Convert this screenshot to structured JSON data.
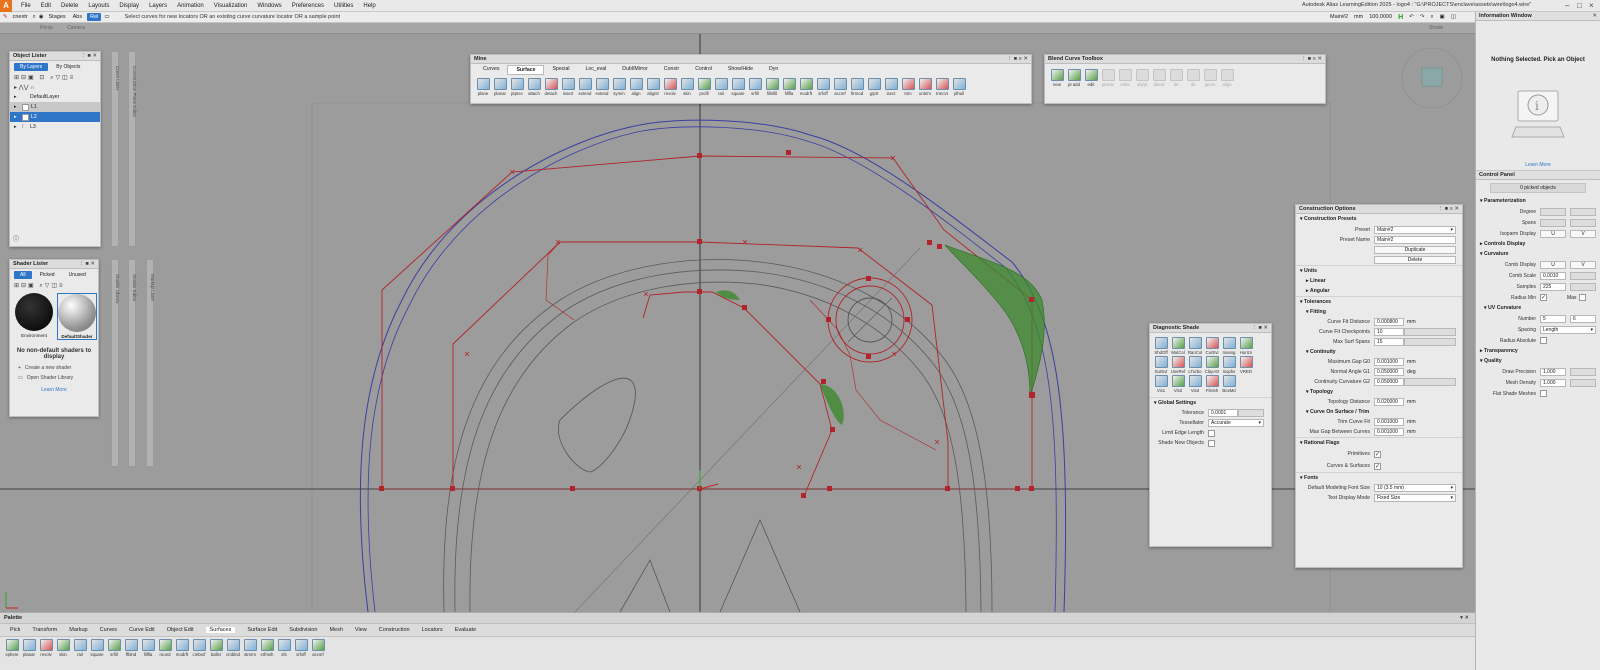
{
  "app": {
    "logo": "A",
    "title": "Autodesk Alias LearningEdition 2025  -  logo4 : \"G:\\PROJECTS\\enclave\\assets\\wire\\logo4.wire\"",
    "menu": [
      "File",
      "Edit",
      "Delete",
      "Layouts",
      "Display",
      "Layers",
      "Animation",
      "Visualization",
      "Windows",
      "Preferences",
      "Utilities",
      "Help"
    ]
  },
  "toolbar": {
    "command": "cnextr",
    "stages": "Stages",
    "abs": "Abs",
    "rel": "Rel",
    "hint": "Select curves for new locators OR an existing curve curvature locator OR a sample point",
    "preset": "Main#2",
    "units": "mm",
    "value": "100.0000"
  },
  "viewport_bar": {
    "items": [
      "Persp",
      "Camera"
    ],
    "right": "Shade"
  },
  "object_lister": {
    "title": "Object Lister",
    "tabs": [
      "By Layers",
      "By Objects"
    ],
    "layers": [
      "DefaultLayer",
      "L1",
      "L2",
      "L3"
    ]
  },
  "shader_lister": {
    "title": "Shader Lister",
    "tabs": [
      "All",
      "Picked",
      "Unused"
    ],
    "shaders": [
      "Environment",
      "DefaultShader"
    ],
    "empty_msg": "No non-default shaders to display",
    "create": "Create a new shader",
    "open": "Open Shader Library",
    "learn": "Learn More"
  },
  "side_bars": [
    "Curve Lister",
    "Construction Plane Editor",
    "Shader Library",
    "Shader Editor",
    "Markup Lister"
  ],
  "mine_shelf": {
    "title": "Mine",
    "tabs": [
      "Curves",
      "Surface",
      "Special",
      "Loc_eval",
      "Dubl/Mirror",
      "Constr",
      "Control",
      "Show/Hide",
      "Dyn"
    ],
    "active_tab": "Surface",
    "tools": [
      "plane",
      "planar",
      "ptprec",
      "attach",
      "detach",
      "insert",
      "extend",
      "extend",
      "symm",
      "align",
      "align0",
      "revolv",
      "skin",
      "profil",
      "rail",
      "square",
      "srfill",
      "fillsfill",
      "fillfla",
      "modrft",
      "srfoff",
      "accsrf",
      "ftrmod",
      "grprt",
      "isect",
      "trim",
      "untrim",
      "trmcvt",
      "plhull"
    ]
  },
  "blend_toolbox": {
    "title": "Blend Curve Toolbox",
    "tools": [
      "new",
      "pt add",
      "edit",
      "planar",
      "ortho",
      "obj/pt",
      "blend",
      "dir",
      "dir",
      "geom",
      "align"
    ]
  },
  "diagnostic_shade": {
    "title": "Diagnostic Shade",
    "icons": [
      "ShdOff",
      "MulCol",
      "RanCol",
      "CurEvl",
      "Isoang",
      "Horizn",
      "SurEvl",
      "UseRef",
      "LTurbo",
      "ClayAO",
      "Isophs",
      "VRED",
      "Vis1",
      "Vis2",
      "Vis3",
      "FileSh",
      "BoxMd"
    ],
    "global_settings": "Global Settings",
    "tolerance_label": "Tolerance",
    "tolerance": "0.0001",
    "tessellator_label": "Tessellator",
    "tessellator": "Accurate",
    "limit_edge": "Limit Edge Length",
    "shade_new": "Shade New Objects"
  },
  "construction_options": {
    "title": "Construction Options",
    "presets_header": "Construction Presets",
    "preset_label": "Preset",
    "preset": "Main#2",
    "preset_name_label": "Preset Name",
    "preset_name": "Main#2",
    "duplicate": "Duplicate",
    "delete": "Delete",
    "units": "Units",
    "linear": "Linear",
    "angular": "Angular",
    "tolerances": "Tolerances",
    "fitting": "Fitting",
    "curve_fit_distance_label": "Curve Fit Distance",
    "curve_fit_distance": "0.000800",
    "curve_fit_checkpoints_label": "Curve Fit Checkpoints",
    "curve_fit_checkpoints": "10",
    "max_surf_spans_label": "Max Surf Spans",
    "max_surf_spans": "15",
    "continuity": "Continuity",
    "max_gap_label": "Maximum Gap G0",
    "max_gap": "0.001000",
    "normal_angle_label": "Normal Angle G1",
    "normal_angle": "0.050000",
    "cont_curv_label": "Continuity Curvature G2",
    "cont_curv": "0.050000",
    "topology": "Topology",
    "topology_distance_label": "Topology Distance",
    "topology_distance": "0.020000",
    "cos_trim": "Curve On Surface / Trim",
    "trim_curve_fit_label": "Trim Curve Fit",
    "trim_curve_fit": "0.001000",
    "max_gap_curves_label": "Max Gap Between Curves",
    "max_gap_curves": "0.001000",
    "rational_flags": "Rational Flags",
    "primitives": "Primitives",
    "curves_surfaces": "Curves & Surfaces",
    "fonts": "Fonts",
    "font_size_label": "Default Modeling Font Size",
    "font_size": "10 (3.5 mm)",
    "text_display_label": "Text Display Mode",
    "text_display": "Fixed Size",
    "mm": "mm",
    "deg": "deg"
  },
  "palette": {
    "title": "Palette",
    "tabs": [
      "Pick",
      "Transform",
      "Markup",
      "Curves",
      "Curve Edit",
      "Object Edit",
      "Surfaces",
      "Surface Edit",
      "Subdivision",
      "Mesh",
      "View",
      "Construction",
      "Locators",
      "Evaluate"
    ],
    "active_tab": "Surfaces",
    "tools": [
      "sphere",
      "planar",
      "revolv",
      "skin",
      "rail",
      "square",
      "srfill",
      "ffblnd",
      "fillfla",
      "round",
      "modrft",
      "cmbsrf",
      "ballsr",
      "cmblnd",
      "strsrm",
      "srfmsh",
      "sfs",
      "srfoff",
      "accsrf"
    ]
  },
  "info_window": {
    "title": "Information Window",
    "msg": "Nothing Selected. Pick an Object",
    "learn": "Learn More"
  },
  "control_panel": {
    "title": "Control Panel",
    "picked": "0 picked objects",
    "parameterization": "Parameterization",
    "degree": "Degree",
    "spans": "Spans",
    "isoparm": "Isoparm Display",
    "u": "U",
    "v": "V",
    "controls_display": "Controls Display",
    "curvature": "Curvature",
    "comb_display": "Comb Display",
    "comb_scale_label": "Comb Scale",
    "comb_scale": "0.0010",
    "samples_label": "Samples",
    "samples": "225",
    "radius_min": "Radius Min",
    "max": "Max",
    "uv_curvature": "UV Curvature",
    "number_label": "Number",
    "number_u": "5",
    "number_v": "6",
    "spacing_label": "Spacing",
    "spacing": "Length",
    "radius_absolute": "Radius Absolute",
    "transparency": "Transparency",
    "quality": "Quality",
    "draw_precision_label": "Draw Precision",
    "draw_precision": "1.000",
    "mesh_density_label": "Mesh Density",
    "mesh_density": "1.000",
    "flat_shade": "Flat Shade Meshes"
  },
  "colors": {
    "accent": "#2f76c9",
    "curve_red": "#b0242a",
    "surface_green": "#3c8a2e",
    "shell_blue": "#3a3fa0"
  }
}
